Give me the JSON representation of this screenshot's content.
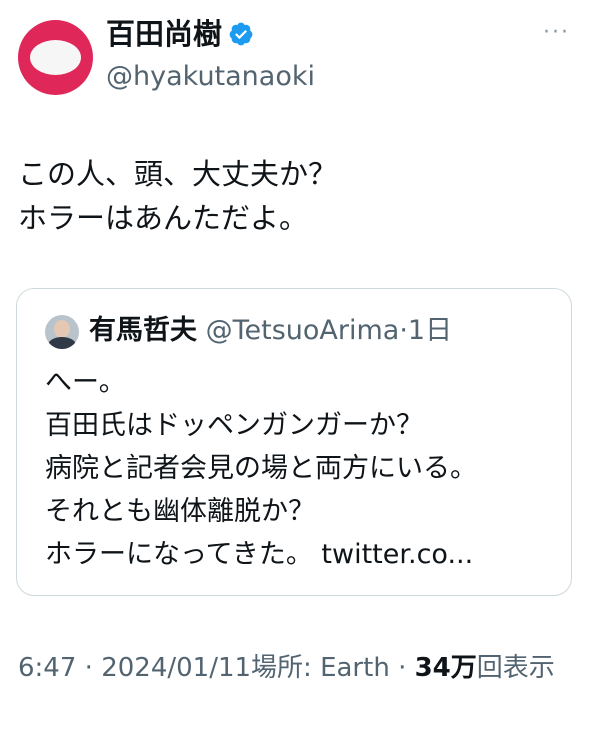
{
  "author": {
    "display_name": "百田尚樹",
    "handle": "@hyakutanaoki",
    "verified": true
  },
  "colors": {
    "avatar_bg": "#e0275a",
    "verified_badge": "#1d9bf0",
    "secondary_text": "#536471"
  },
  "tweet": {
    "lines": [
      "この人、頭、大丈夫か？",
      "ホラーはあんただよ。"
    ]
  },
  "quoted": {
    "display_name": "有馬哲夫",
    "handle": "@TetsuoArima",
    "separator": "·",
    "time": "1日",
    "lines": [
      "へー。",
      "百田氏はドッペンガンガーか？",
      "病院と記者会見の場と両方にいる。",
      "それとも幽体離脱か？",
      "ホラーになってきた。 twitter.co..."
    ]
  },
  "meta": {
    "time": "6:47",
    "dot": "·",
    "date": "2024/01/11",
    "location": "場所: Earth",
    "views_count": "34万",
    "views_label": "回表示"
  },
  "icons": {
    "more": "more-icon",
    "verified": "verified-badge-icon"
  }
}
